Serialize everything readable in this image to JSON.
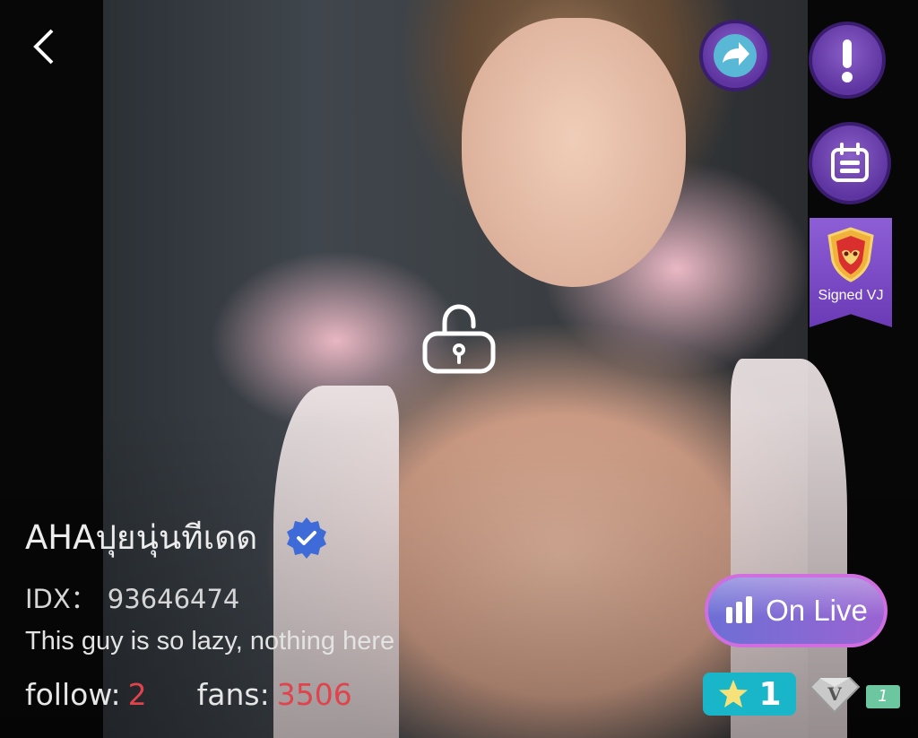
{
  "nav": {
    "back_icon": "chevron-left-icon"
  },
  "actions": {
    "share_icon": "share-arrow-icon",
    "report_icon": "exclamation-icon",
    "calendar_icon": "calendar-icon"
  },
  "badge": {
    "signed_label": "Signed VJ",
    "icon": "mask-shield-icon"
  },
  "lock_icon": "unlock-icon",
  "profile": {
    "name": "AHAปุยนุ่นทีเดด",
    "verified_icon": "verified-badge-icon",
    "idx_label": "IDX：",
    "idx_value": "93646474",
    "bio": "This guy is so lazy, nothing here"
  },
  "stats": {
    "follow_label": "follow:",
    "follow_value": "2",
    "fans_label": "fans:",
    "fans_value": "3506"
  },
  "live": {
    "label": "On Live",
    "icon": "signal-bars-icon"
  },
  "level": {
    "value": "1",
    "icon": "star-icon"
  },
  "vip": {
    "letter": "V",
    "value": "1",
    "icon": "diamond-icon"
  },
  "colors": {
    "accent": "#6a3ab6",
    "count_red": "#e0434c",
    "level_teal": "#18b6c8"
  }
}
